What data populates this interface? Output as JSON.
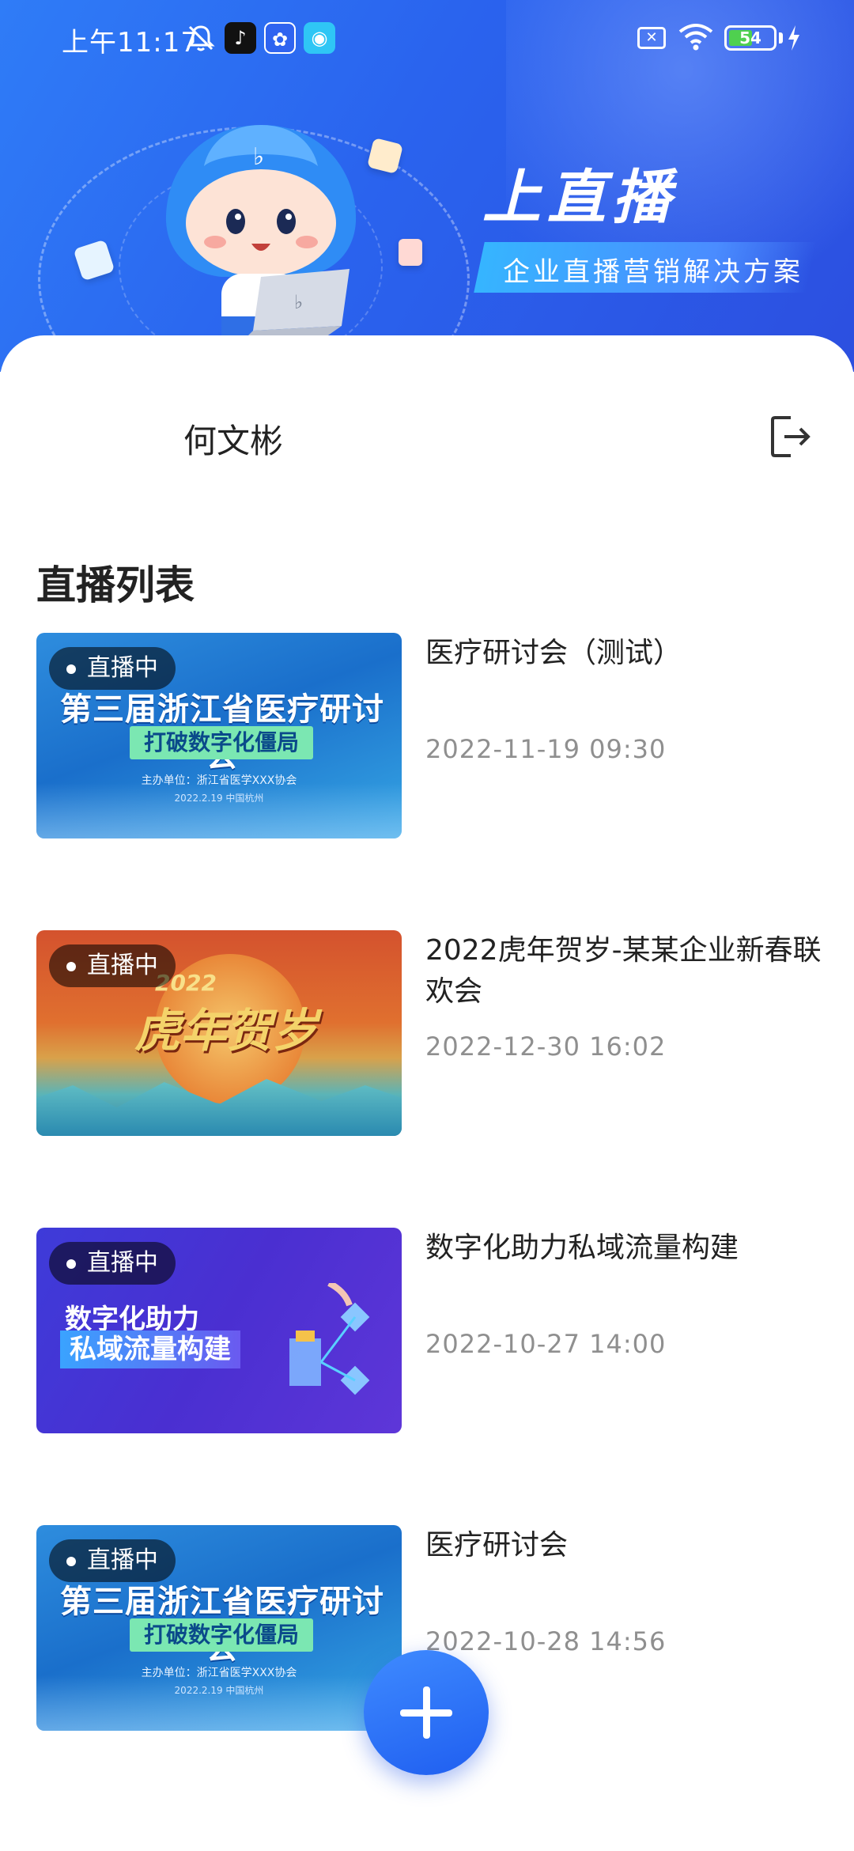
{
  "status_bar": {
    "time": "上午11:17",
    "battery": "54",
    "battery_level": 0.54
  },
  "banner": {
    "title": "上直播",
    "tagline": "企业直播营销解决方案"
  },
  "user": {
    "name": "何文彬"
  },
  "section_title": "直播列表",
  "live_badge": "直播中",
  "streams": [
    {
      "title": "医疗研讨会（测试）",
      "date": "2022-11-19 09:30",
      "thumb": {
        "headline": "第三届浙江省医疗研讨会",
        "sub": "打破数字化僵局",
        "small": "主办单位：浙江省医学XXX协会",
        "small2": "2022.2.19  中国杭州"
      }
    },
    {
      "title": "2022虎年贺岁-某某企业新春联欢会",
      "date": "2022-12-30 16:02",
      "thumb": {
        "year": "2022",
        "headline": "虎年贺岁"
      }
    },
    {
      "title": "数字化助力私域流量构建",
      "date": "2022-10-27 14:00",
      "thumb": {
        "line1": "数字化助力",
        "line2": "私域流量构建"
      }
    },
    {
      "title": "医疗研讨会",
      "date": "2022-10-28 14:56",
      "thumb": {
        "headline": "第三届浙江省医疗研讨会",
        "sub": "打破数字化僵局",
        "small": "主办单位：浙江省医学XXX协会",
        "small2": "2022.2.19  中国杭州"
      }
    }
  ],
  "colors": {
    "primary": "#2a63ee",
    "live_badge_bg": "#000000",
    "date_text": "#8f8f8f"
  },
  "icons": [
    "mute-icon",
    "tiktok-icon",
    "baidu-icon",
    "message-icon",
    "sim-icon",
    "wifi-icon",
    "battery-icon",
    "charge-icon",
    "logout-icon",
    "plus-icon"
  ]
}
